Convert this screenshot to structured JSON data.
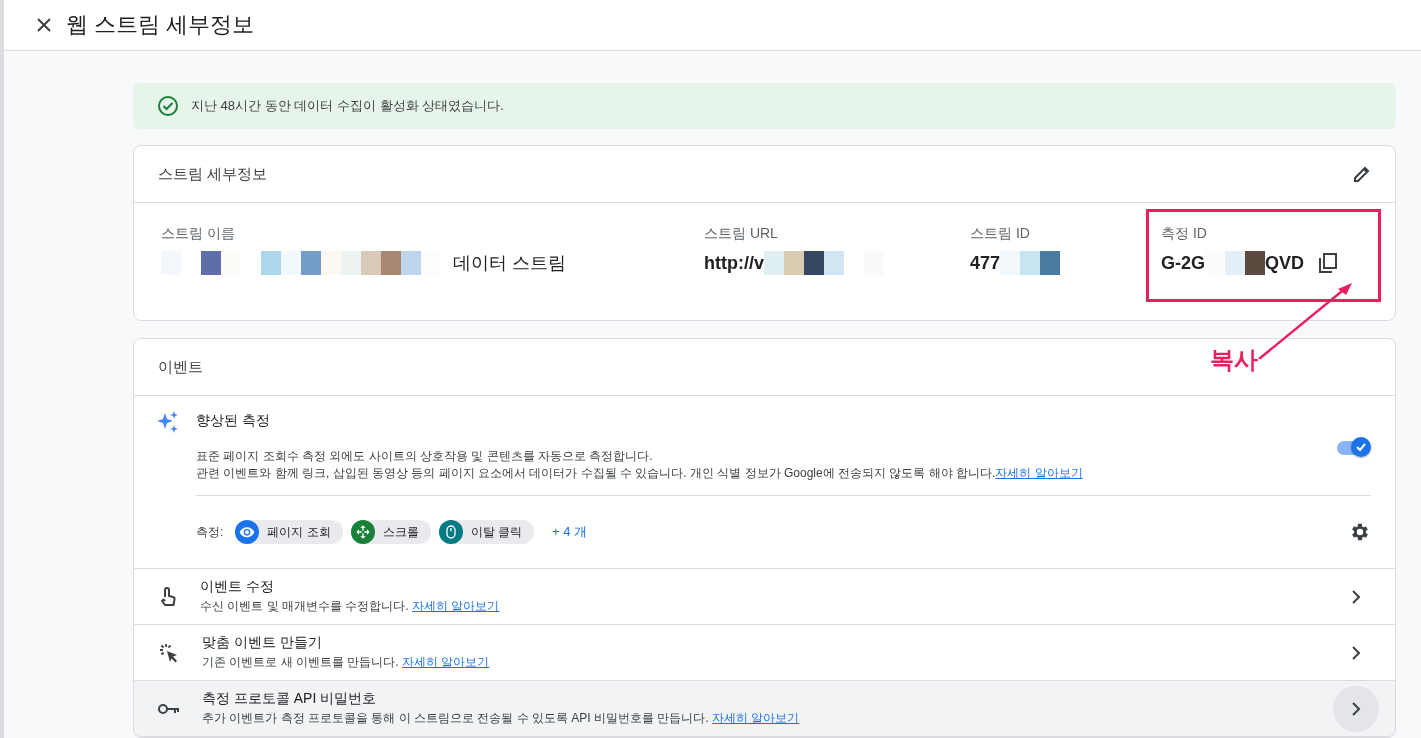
{
  "header": {
    "title": "웹 스트림 세부정보"
  },
  "banner": {
    "text": "지난 48시간 동안 데이터 수집이 활성화 상태였습니다."
  },
  "stream_details": {
    "title": "스트림 세부정보",
    "fields": [
      {
        "label": "스트림 이름",
        "suffix": "데이터 스트림",
        "bold": false,
        "highlighted": false
      },
      {
        "label": "스트림 URL",
        "prefix": "http://v",
        "bold": true,
        "highlighted": false
      },
      {
        "label": "스트림 ID",
        "prefix": "477",
        "bold": true,
        "highlighted": false
      },
      {
        "label": "측정 ID",
        "prefix": "G-2G",
        "suffix": "QVD",
        "bold": true,
        "highlighted": true
      }
    ]
  },
  "annotation": {
    "label": "복사"
  },
  "events": {
    "title": "이벤트",
    "enhanced": {
      "title": "향상된 측정",
      "lines": [
        "표준 페이지 조회수 측정 외에도 사이트의 상호작용 및 콘텐츠를 자동으로 측정합니다.",
        "관련 이벤트와 함께 링크, 삽입된 동영상 등의 페이지 요소에서 데이터가 수집될 수 있습니다. 개인 식별 정보가 Google에 전송되지 않도록 해야 합니다."
      ],
      "link": "자세히 알아보기",
      "on": true,
      "measures_label": "측정:",
      "chips": [
        {
          "kind": "eye",
          "label": "페이지 조회",
          "color": "#1a73e8"
        },
        {
          "kind": "scroll",
          "label": "스크롤",
          "color": "#188038"
        },
        {
          "kind": "mouse",
          "label": "이탈 클릭",
          "color": "#007b83"
        }
      ],
      "more": "+ 4 개"
    },
    "rows": [
      {
        "kind": "touch",
        "title": "이벤트 수정",
        "desc": "수신 이벤트 및 매개변수를 수정합니다.",
        "link": "자세히 알아보기",
        "hovered": false
      },
      {
        "kind": "click",
        "title": "맞춤 이벤트 만들기",
        "desc": "기존 이벤트로 새 이벤트를 만듭니다.",
        "link": "자세히 알아보기",
        "hovered": false
      },
      {
        "kind": "key",
        "title": "측정 프로토콜 API 비밀번호",
        "desc": "추가 이벤트가 측정 프로토콜을 통해 이 스트림으로 전송될 수 있도록 API 비밀번호를 만듭니다.",
        "link": "자세히 알아보기",
        "hovered": true
      }
    ]
  }
}
